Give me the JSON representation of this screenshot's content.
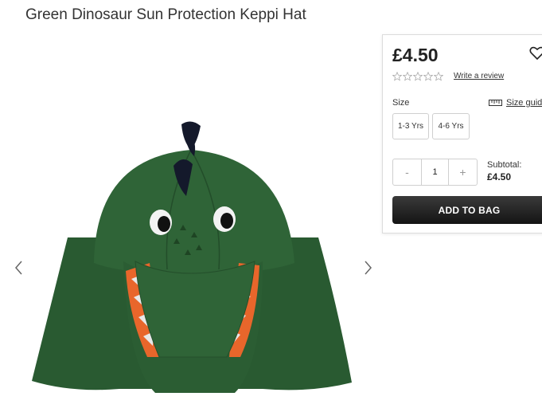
{
  "product": {
    "title": "Green Dinosaur Sun Protection Keppi Hat",
    "image_alt_icon": "hat-product-image"
  },
  "gallery": {
    "prev_icon": "chevron-left-icon",
    "next_icon": "chevron-right-icon"
  },
  "panel": {
    "price": "£4.50",
    "wishlist_icon": "heart-icon",
    "rating_stars": 5,
    "rating_value": 0,
    "write_review": "Write a review",
    "size_label": "Size",
    "size_guide": "Size guide",
    "sizes": [
      "1-3 Yrs",
      "4-6 Yrs"
    ],
    "qty_minus": "-",
    "qty_value": "1",
    "qty_plus": "+",
    "subtotal_label": "Subtotal:",
    "subtotal_value": "£4.50",
    "add_to_bag": "ADD TO BAG"
  },
  "colors": {
    "hat_green": "#2d5e34",
    "hat_orange": "#e8662b",
    "button_dark": "#1e1e1e"
  }
}
